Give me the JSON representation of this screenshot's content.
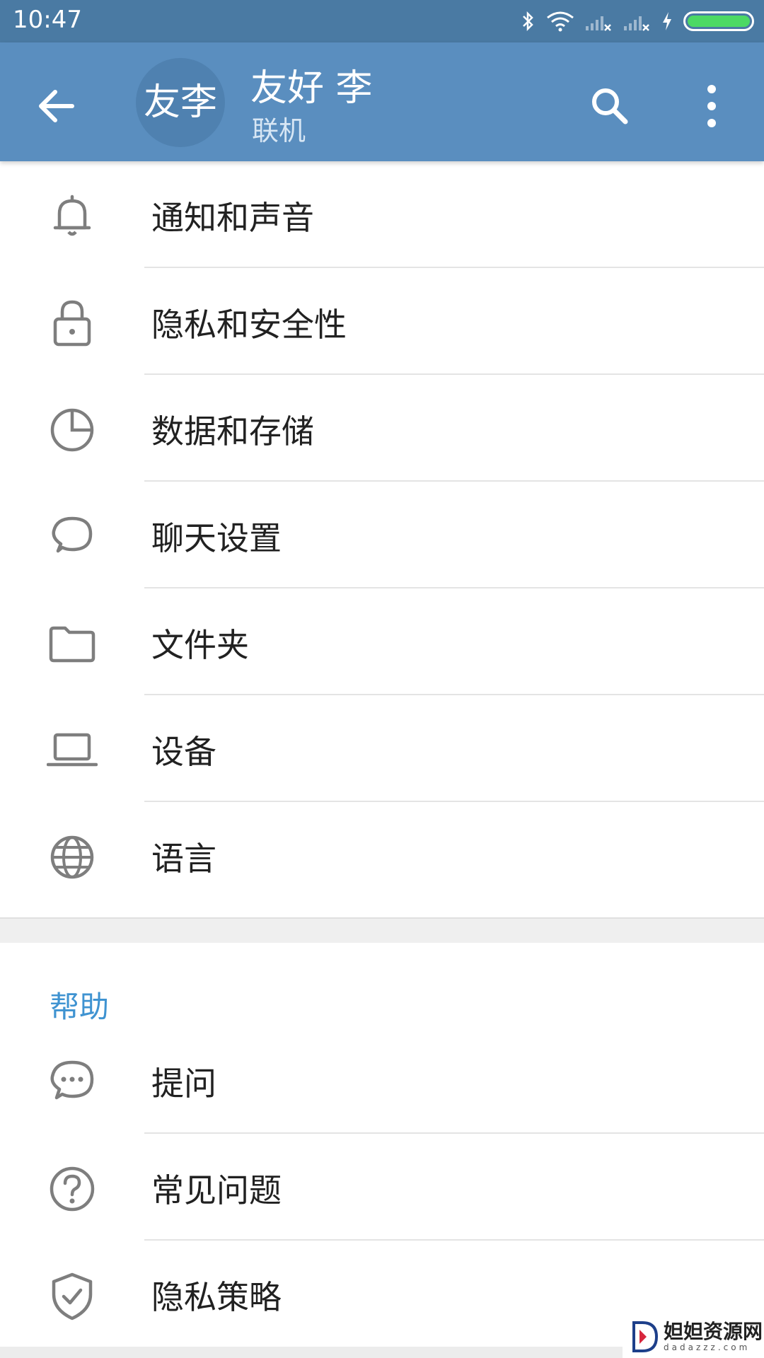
{
  "status_bar": {
    "time": "10:47",
    "icons": [
      "bluetooth-icon",
      "wifi-icon",
      "signal-icon",
      "signal-icon",
      "charging-icon",
      "battery-icon"
    ],
    "battery_color": "#4cd964"
  },
  "app_bar": {
    "avatar_text": "友李",
    "name": "友好 李",
    "status": "联机",
    "bg_color": "#5a8ebf"
  },
  "settings": {
    "items": [
      {
        "label": "通知和声音",
        "icon": "bell-icon"
      },
      {
        "label": "隐私和安全性",
        "icon": "lock-icon"
      },
      {
        "label": "数据和存储",
        "icon": "pie-chart-icon"
      },
      {
        "label": "聊天设置",
        "icon": "chat-bubble-icon"
      },
      {
        "label": "文件夹",
        "icon": "folder-icon"
      },
      {
        "label": "设备",
        "icon": "laptop-icon"
      },
      {
        "label": "语言",
        "icon": "globe-icon"
      }
    ]
  },
  "help": {
    "header": "帮助",
    "header_color": "#3f93d1",
    "items": [
      {
        "label": "提问",
        "icon": "chat-dots-icon"
      },
      {
        "label": "常见问题",
        "icon": "question-icon"
      },
      {
        "label": "隐私策略",
        "icon": "shield-check-icon"
      }
    ]
  },
  "watermark": {
    "text": "妲妲资源网",
    "sub": "dadazzz.com"
  }
}
